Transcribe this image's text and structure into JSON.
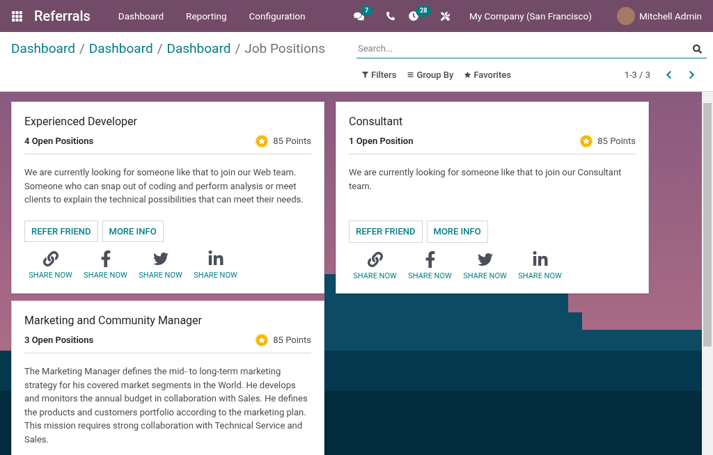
{
  "navbar": {
    "app_name": "Referrals",
    "menu": [
      "Dashboard",
      "Reporting",
      "Configuration"
    ],
    "chat_badge": "7",
    "activity_badge": "28",
    "company": "My Company (San Francisco)",
    "user": "Mitchell Admin"
  },
  "breadcrumb_separator": "/",
  "breadcrumbs": [
    {
      "label": "Dashboard",
      "current": false
    },
    {
      "label": "Dashboard",
      "current": false
    },
    {
      "label": "Dashboard",
      "current": false
    },
    {
      "label": "Job Positions",
      "current": true
    }
  ],
  "search": {
    "placeholder": "Search..."
  },
  "search_options": [
    {
      "kind": "filter",
      "label": "Filters"
    },
    {
      "kind": "group",
      "label": "Group By"
    },
    {
      "kind": "favorite",
      "label": "Favorites"
    }
  ],
  "pager": "1-3 / 3",
  "jobs": [
    {
      "title": "Experienced Developer",
      "open_positions": "4 Open Positions",
      "points": "85 Points",
      "description": "We are currently looking for someone like that to join our Web team. Someone who can snap out of coding and perform analysis or meet clients to explain the technical possibilities that can meet their needs.",
      "buttons": [
        "REFER FRIEND",
        "MORE INFO"
      ],
      "shares": [
        {
          "kind": "link",
          "label": "SHARE NOW"
        },
        {
          "kind": "facebook",
          "label": "SHARE NOW"
        },
        {
          "kind": "twitter",
          "label": "SHARE NOW"
        },
        {
          "kind": "linkedin",
          "label": "SHARE NOW"
        }
      ]
    },
    {
      "title": "Consultant",
      "open_positions": "1 Open Position",
      "points": "85 Points",
      "description": "We are currently looking for someone like that to join our Consultant team.",
      "buttons": [
        "REFER FRIEND",
        "MORE INFO"
      ],
      "shares": [
        {
          "kind": "link",
          "label": "SHARE NOW"
        },
        {
          "kind": "facebook",
          "label": "SHARE NOW"
        },
        {
          "kind": "twitter",
          "label": "SHARE NOW"
        },
        {
          "kind": "linkedin",
          "label": "SHARE NOW"
        }
      ]
    },
    {
      "title": "Marketing and Community Manager",
      "open_positions": "3 Open Positions",
      "points": "85 Points",
      "description": "The Marketing Manager defines the mid- to long-term marketing strategy for his covered market segments in the World. He develops and monitors the annual budget in collaboration with Sales. He defines the products and customers portfolio according to the marketing plan. This mission requires strong collaboration with Technical Service and Sales."
    }
  ]
}
